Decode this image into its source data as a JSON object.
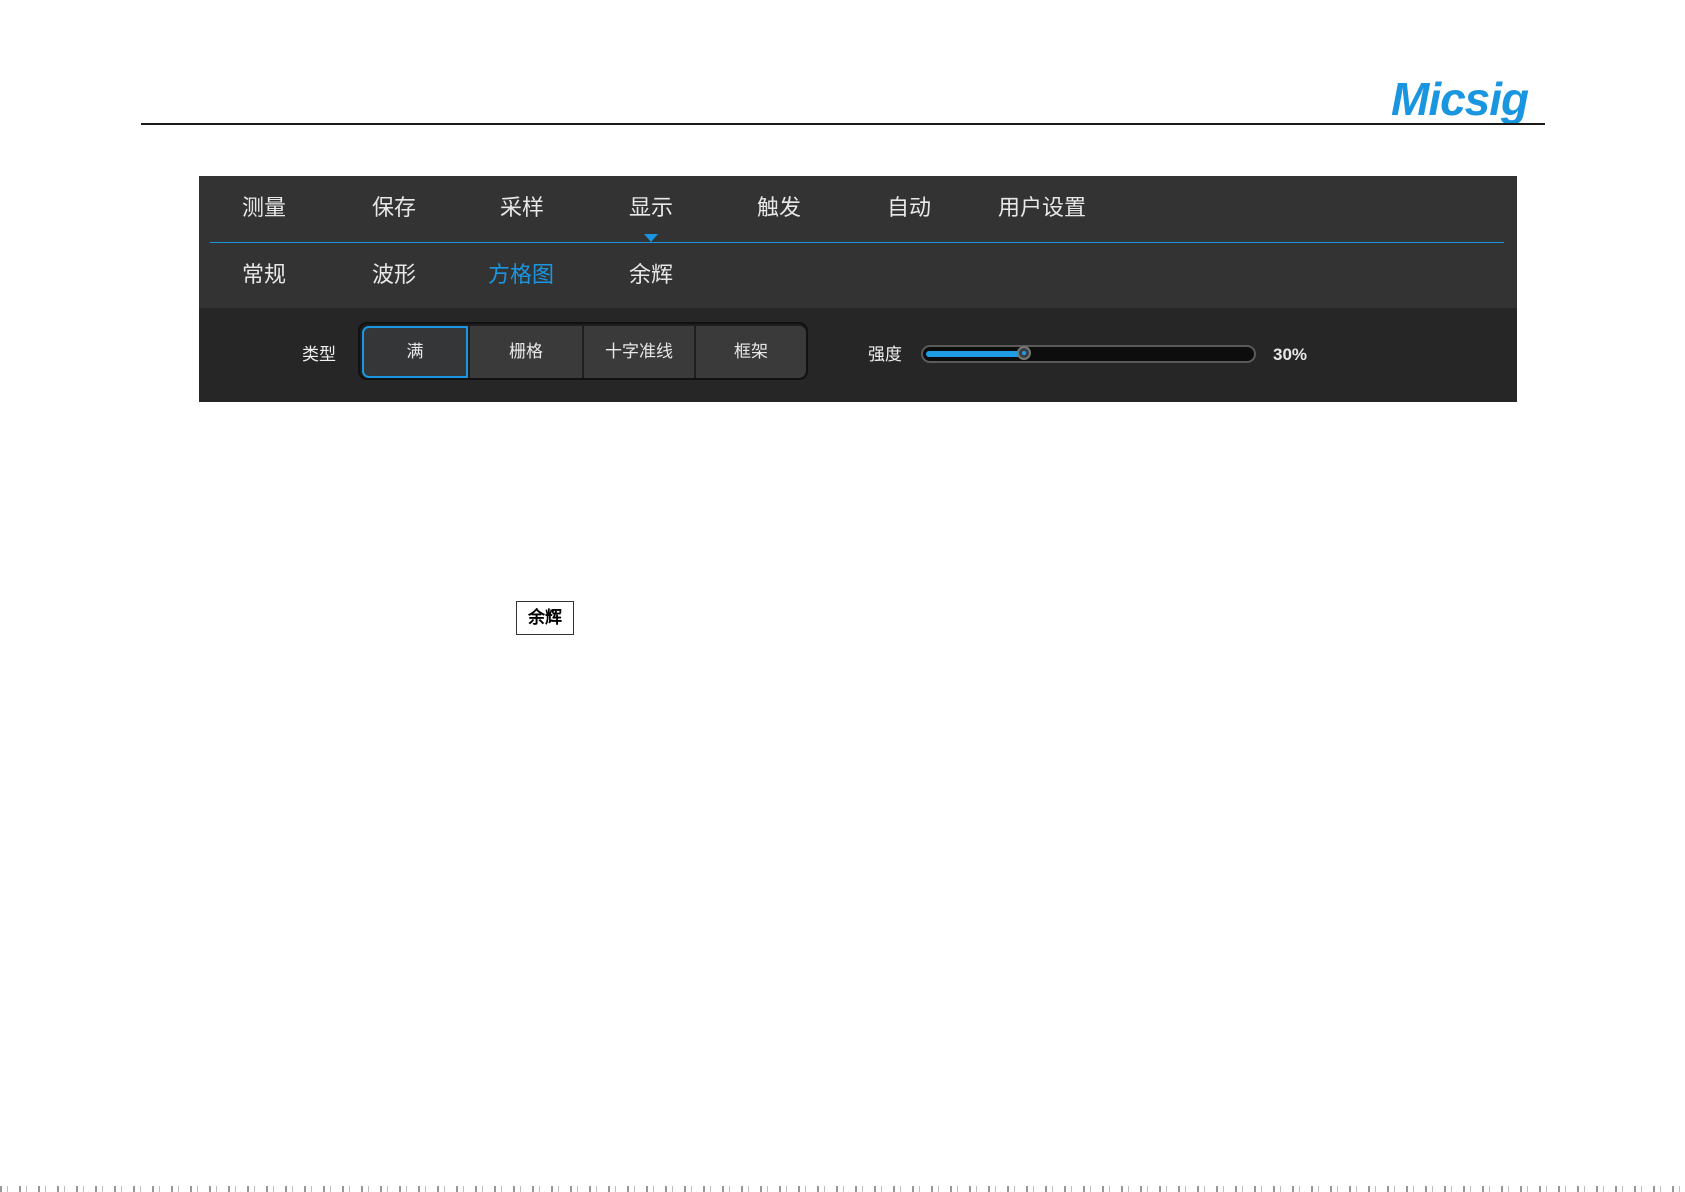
{
  "brand": {
    "logo_text": "Micsig",
    "color": "#1a96e0"
  },
  "menu": {
    "items": [
      {
        "label": "测量"
      },
      {
        "label": "保存"
      },
      {
        "label": "采样"
      },
      {
        "label": "显示",
        "active": true
      },
      {
        "label": "触发"
      },
      {
        "label": "自动"
      },
      {
        "label": "用户设置"
      }
    ]
  },
  "submenu": {
    "items": [
      {
        "label": "常规"
      },
      {
        "label": "波形"
      },
      {
        "label": "方格图",
        "active": true
      },
      {
        "label": "余辉"
      }
    ]
  },
  "grid_settings": {
    "type_label": "类型",
    "type_options": [
      {
        "label": "满",
        "selected": true
      },
      {
        "label": "栅格"
      },
      {
        "label": "十字准线"
      },
      {
        "label": "框架"
      }
    ],
    "intensity_label": "强度",
    "intensity_value": 30,
    "intensity_display": "30%"
  },
  "caption": {
    "label": "余辉"
  },
  "colors": {
    "accent": "#1a96e0",
    "panel_bg": "#333333",
    "row_bg": "#262626"
  }
}
